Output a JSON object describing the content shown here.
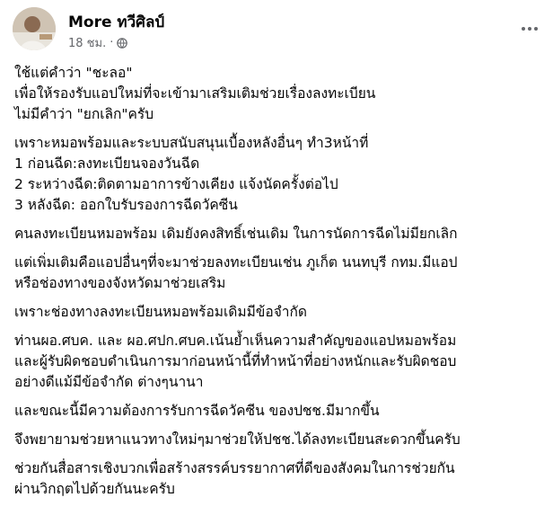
{
  "post": {
    "author": "More ทวีศิลป์",
    "time": "18 ชม.",
    "separator": "·",
    "privacy_icon": "globe-icon",
    "more_icon": "more-options-icon",
    "paragraphs": [
      [
        "ใช้แต่คำว่า \"ชะลอ\"",
        "เพื่อให้รองรับแอปใหม่ที่จะเข้ามาเสริมเติมช่วยเรื่องลงทะเบียน",
        "ไม่มีคำว่า \"ยกเลิก\"ครับ"
      ],
      [
        "เพราะหมอพร้อมและระบบสนับสนุนเบื้องหลังอื่นๆ ทำ3หน้าที่",
        "1 ก่อนฉีด:ลงทะเบียนจองวันฉีด",
        "2 ระหว่างฉีด:ติดตามอาการข้างเคียง แจ้งนัดครั้งต่อไป",
        "3 หลังฉีด: ออกใบรับรองการฉีดวัคซีน"
      ],
      [
        "คนลงทะเบียนหมอพร้อม เดิมยังคงสิทธิ์เช่นเดิม ในการนัดการฉีดไม่มียกเลิก"
      ],
      [
        "แต่เพิ่มเติมคือแอปอื่นๆที่จะมาช่วยลงทะเบียนเช่น ภูเก็ต นนทบุรี กทม.มีแอป",
        "หรือช่องทางของจังหวัดมาช่วยเสริม"
      ],
      [
        "เพราะช่องทางลงทะเบียนหมอพร้อมเดิมมีข้อจำกัด"
      ],
      [
        "ท่านผอ.ศบค. และ ผอ.ศปก.ศบค.เน้นย้ำเห็นความสำคัญของแอปหมอพร้อม",
        "และผู้รับผิดชอบดำเนินการมาก่อนหน้านี้ที่ทำหน้าที่อย่างหนักและรับผิดชอบ",
        "อย่างดีแม้มีข้อจำกัด ต่างๆนานา"
      ],
      [
        "และขณะนี้มีความต้องการรับการฉีดวัคซีน ของปชช.มีมากขึ้น"
      ],
      [
        "จึงพยายามช่วยหาแนวทางใหม่ๆมาช่วยให้ปชช.ได้ลงทะเบียนสะดวกขึ้นครับ"
      ],
      [
        "ช่วยกันสื่อสารเชิงบวกเพื่อสร้างสรรค์บรรยากาศที่ดีของสังคมในการช่วยกัน",
        "ผ่านวิกฤตไปด้วยกันนะครับ"
      ]
    ]
  }
}
